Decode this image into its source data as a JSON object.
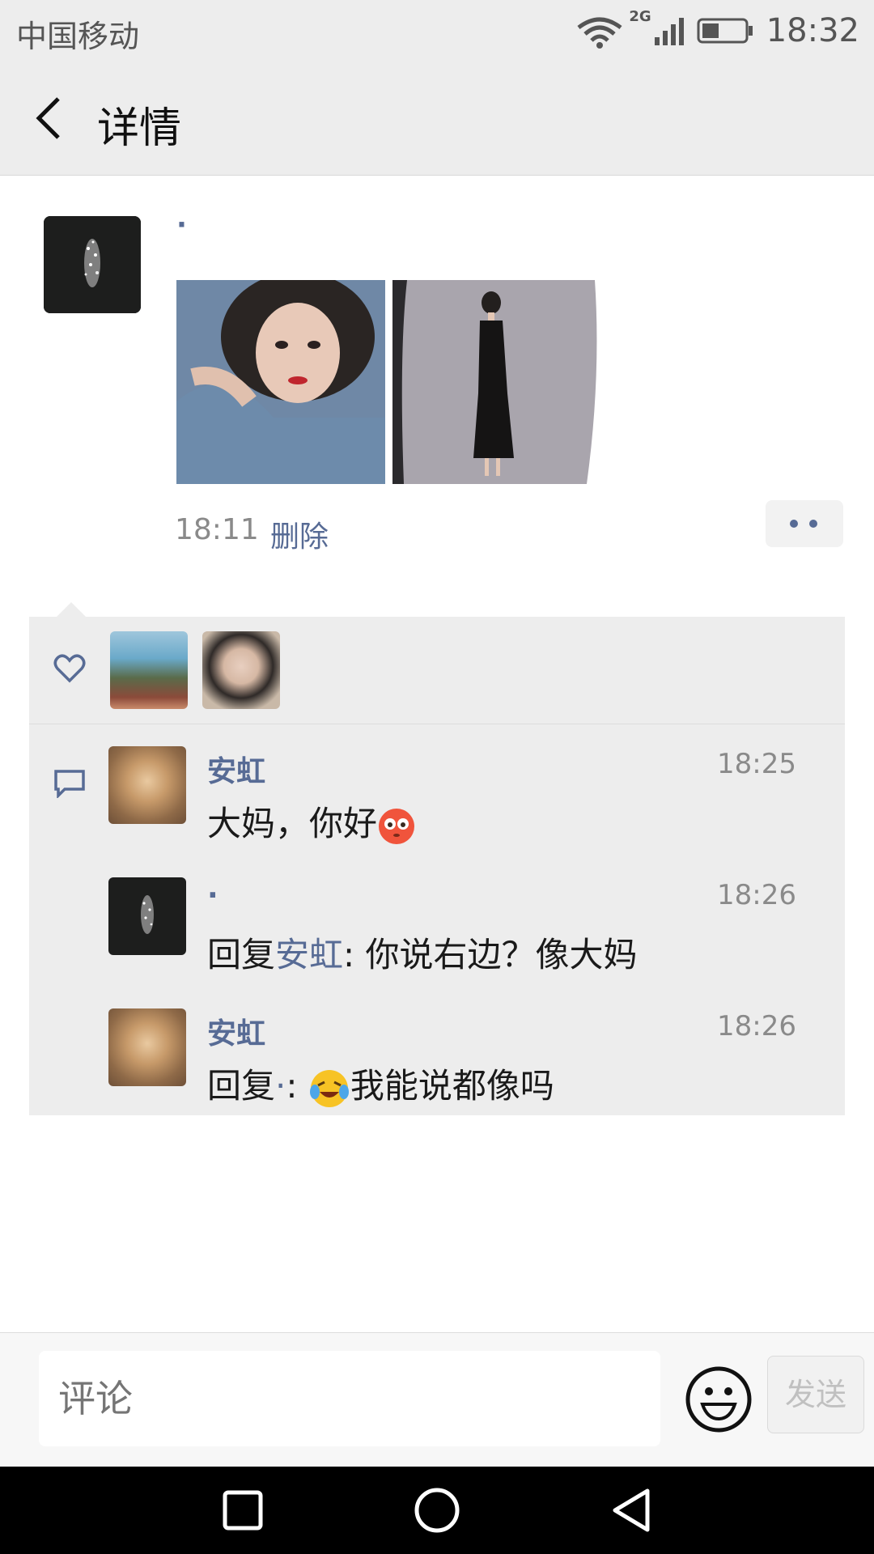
{
  "status_bar": {
    "carrier": "中国移动",
    "network": "2G",
    "time": "18:32"
  },
  "header": {
    "title": "详情"
  },
  "post": {
    "author": "·",
    "time": "18:11",
    "delete_label": "删除"
  },
  "comments": [
    {
      "name": "安虹",
      "time": "18:25",
      "text": "大妈，你好"
    },
    {
      "name": "·",
      "time": "18:26",
      "reply_prefix": "回复",
      "reply_to": "安虹",
      "text": ": 你说右边？像大妈"
    },
    {
      "name": "安虹",
      "time": "18:26",
      "reply_prefix": "回复",
      "reply_to": "·",
      "text": "我能说都像吗"
    }
  ],
  "input": {
    "placeholder": "评论",
    "send_label": "发送"
  },
  "colors": {
    "link_blue": "#576b95",
    "panel_bg": "#ededed"
  }
}
